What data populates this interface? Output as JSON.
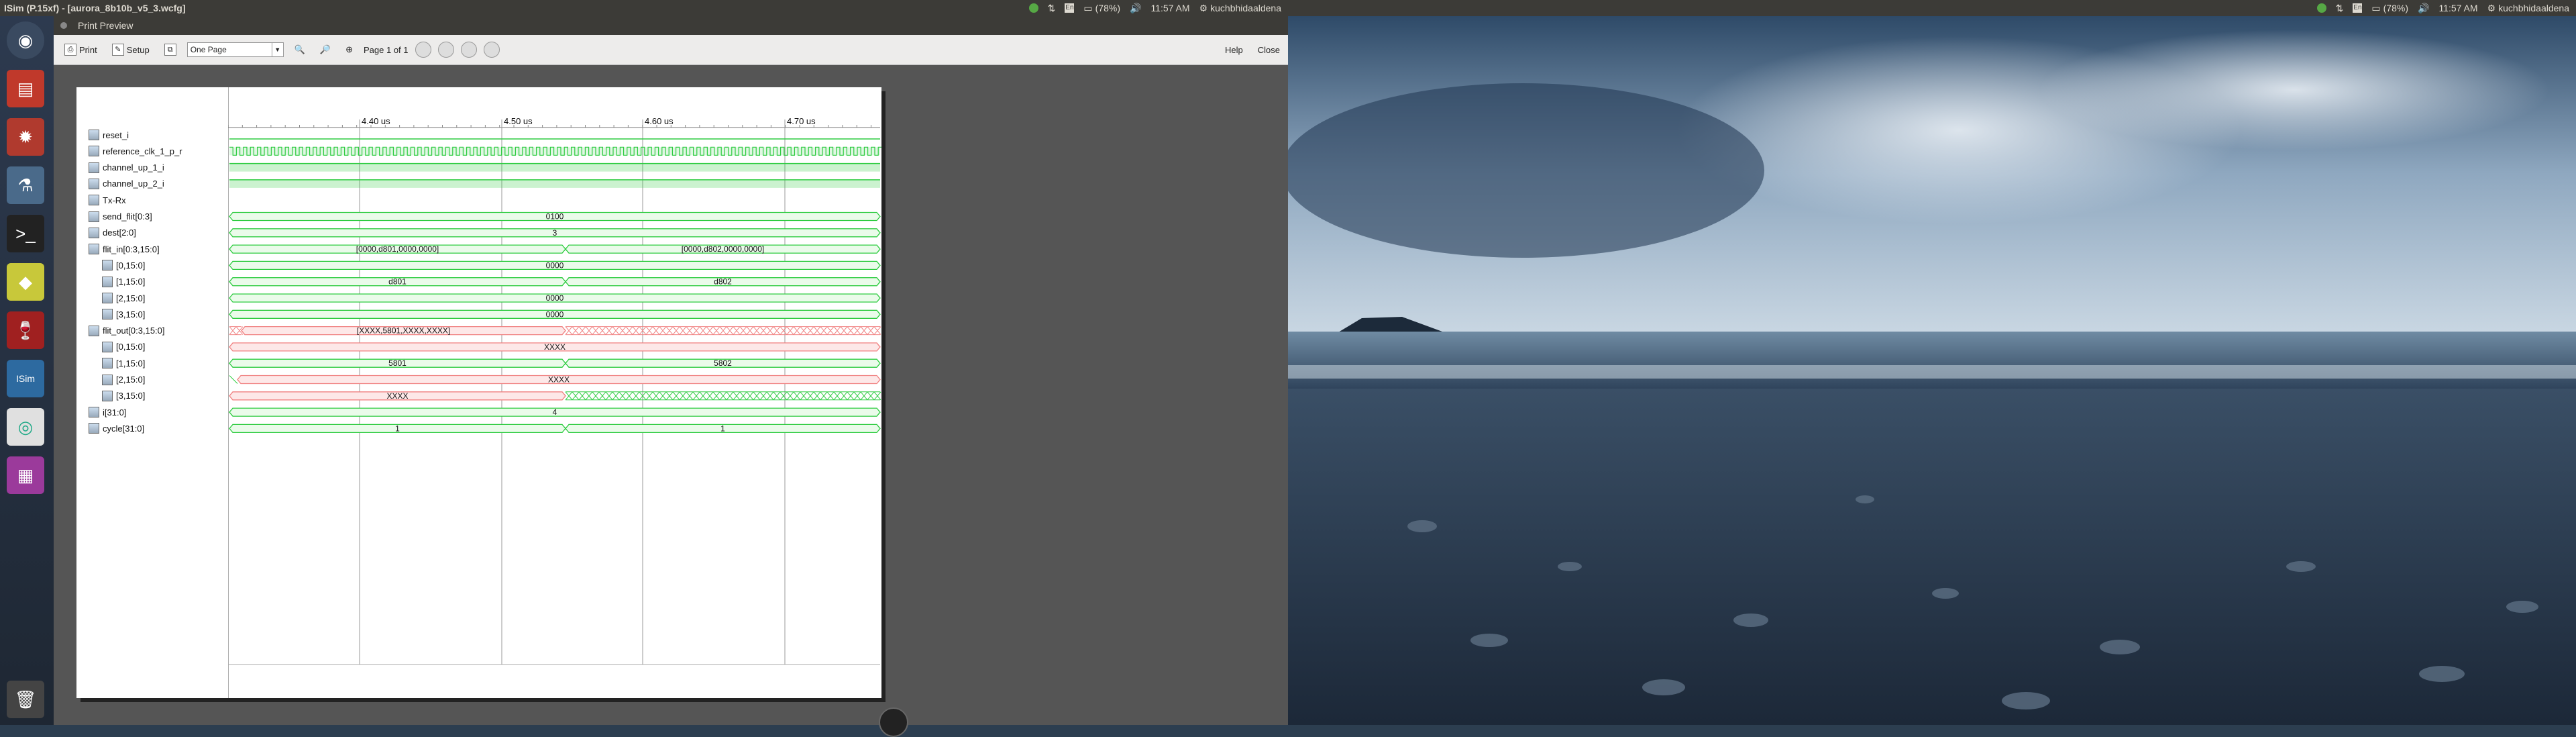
{
  "topbar_left": {
    "title": "ISim (P.15xf) - [aurora_8b10b_v5_3.wcfg]",
    "battery": "(78%)",
    "time": "11:57 AM",
    "user": "kuchbhidaaldena"
  },
  "topbar_right": {
    "battery": "(78%)",
    "time": "11:57 AM",
    "user": "kuchbhidaaldena"
  },
  "window": {
    "title": "Print Preview",
    "toolbar": {
      "print_label": "Print",
      "setup_label": "Setup",
      "view_select": "One Page",
      "page_status": "Page 1 of 1",
      "help_label": "Help",
      "close_label": "Close"
    }
  },
  "timeline": {
    "ticks": [
      "4.40 us",
      "4.50 us",
      "4.60 us",
      "4.70 us"
    ]
  },
  "signals": [
    {
      "name": "reset_i",
      "child": false
    },
    {
      "name": "reference_clk_1_p_r",
      "child": false
    },
    {
      "name": "channel_up_1_i",
      "child": false
    },
    {
      "name": "channel_up_2_i",
      "child": false
    },
    {
      "name": "Tx-Rx",
      "child": false
    },
    {
      "name": "send_flit[0:3]",
      "child": false
    },
    {
      "name": "dest[2:0]",
      "child": false
    },
    {
      "name": "flit_in[0:3,15:0]",
      "child": false
    },
    {
      "name": "[0,15:0]",
      "child": true
    },
    {
      "name": "[1,15:0]",
      "child": true
    },
    {
      "name": "[2,15:0]",
      "child": true
    },
    {
      "name": "[3,15:0]",
      "child": true
    },
    {
      "name": "flit_out[0:3,15:0]",
      "child": false
    },
    {
      "name": "[0,15:0]",
      "child": true
    },
    {
      "name": "[1,15:0]",
      "child": true
    },
    {
      "name": "[2,15:0]",
      "child": true
    },
    {
      "name": "[3,15:0]",
      "child": true
    },
    {
      "name": "i[31:0]",
      "child": false
    },
    {
      "name": "cycle[31:0]",
      "child": false
    }
  ],
  "bus_values": {
    "send_flit": "0100",
    "dest": "3",
    "flit_in_a": "[0000,d801,0000,0000]",
    "flit_in_b": "[0000,d802,0000,0000]",
    "flit_in_0": "0000",
    "flit_in_1_a": "d801",
    "flit_in_1_b": "d802",
    "flit_in_2": "0000",
    "flit_in_3": "0000",
    "flit_out_a": "[XXXX,5801,XXXX,XXXX]",
    "flit_out_0": "XXXX",
    "flit_out_1_a": "5801",
    "flit_out_1_b": "5802",
    "flit_out_2": "XXXX",
    "flit_out_3": "XXXX",
    "i": "4",
    "cycle_a": "1",
    "cycle_b": "1"
  }
}
